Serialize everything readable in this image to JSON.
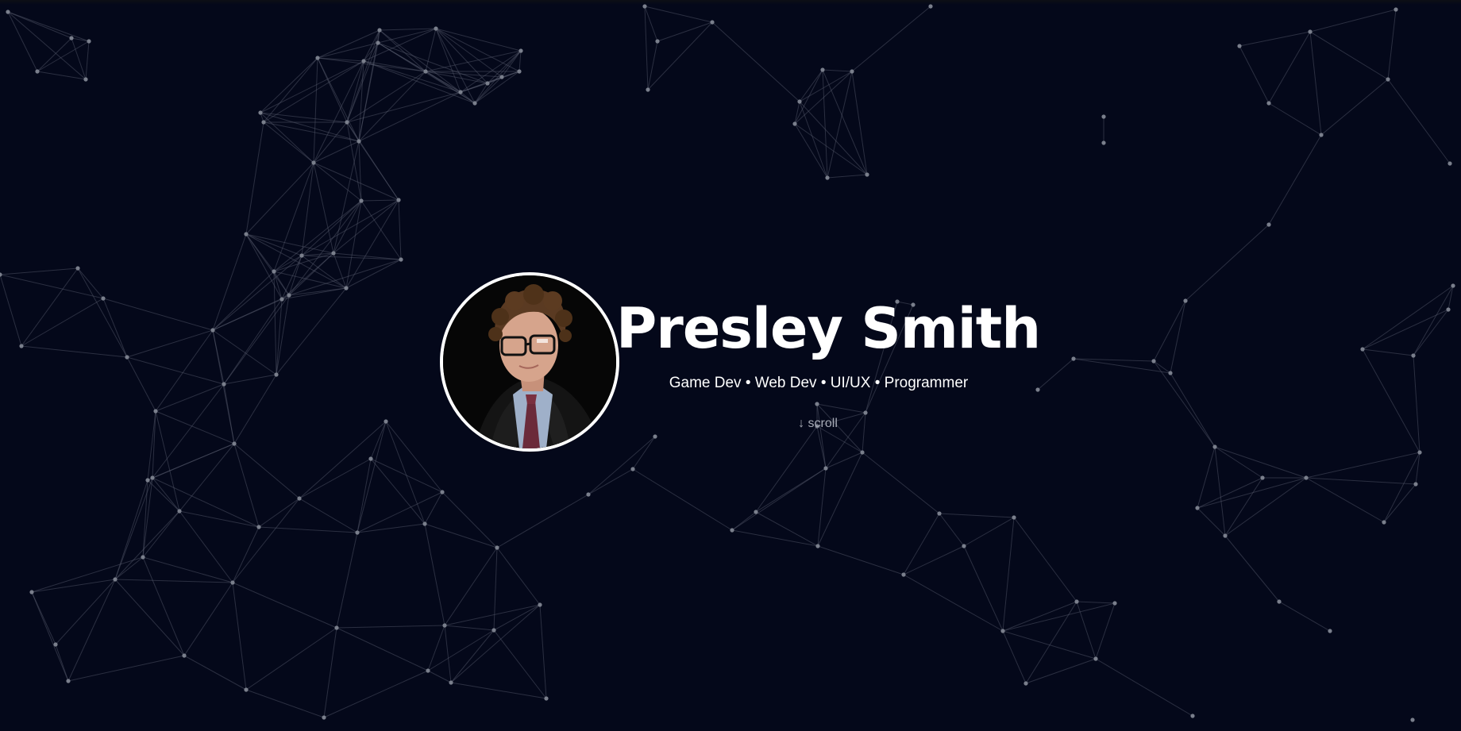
{
  "hero": {
    "name": "Presley Smith",
    "roles": "Game Dev • Web Dev • UI/UX • Programmer",
    "scroll_hint": "↓ scroll"
  },
  "theme": {
    "background": "#04081a",
    "node_color": "#7a7f8c",
    "link_color": "#5a6070",
    "text_color": "#ffffff",
    "muted_text": "#a7abb6"
  }
}
